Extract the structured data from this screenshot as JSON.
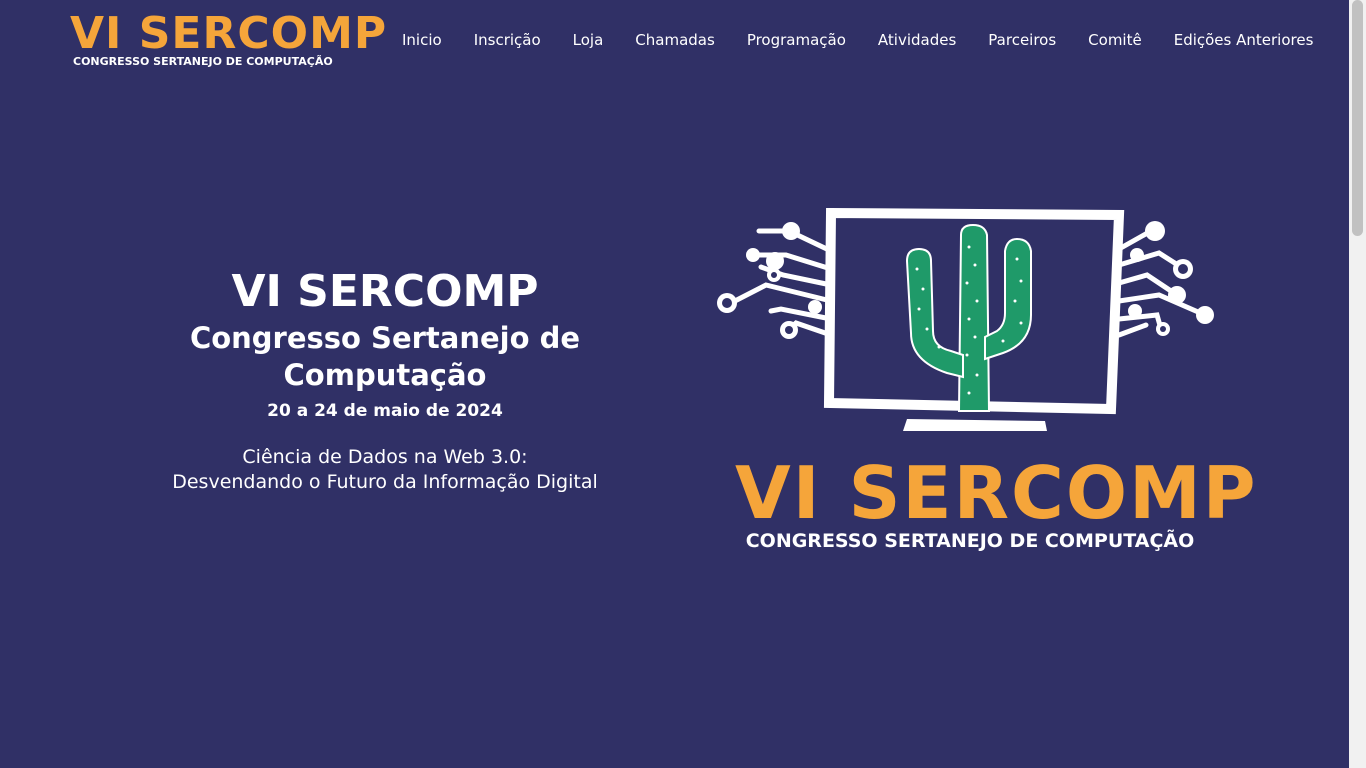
{
  "header": {
    "brand_title": "VI SERCOMP",
    "brand_subtitle": "CONGRESSO SERTANEJO DE COMPUTAÇÃO",
    "nav": [
      {
        "label": "Inicio"
      },
      {
        "label": "Inscrição"
      },
      {
        "label": "Loja"
      },
      {
        "label": "Chamadas"
      },
      {
        "label": "Programação"
      },
      {
        "label": "Atividades"
      },
      {
        "label": "Parceiros"
      },
      {
        "label": "Comitê"
      },
      {
        "label": "Edições Anteriores"
      }
    ]
  },
  "hero": {
    "title": "VI SERCOMP",
    "subtitle": "Congresso Sertanejo de Computação",
    "date": "20 a 24 de maio de 2024",
    "theme_line1": "Ciência de Dados na Web 3.0:",
    "theme_line2": "Desvendando o Futuro da Informação Digital"
  },
  "illustration": {
    "logo_title": "VI SERCOMP",
    "logo_subtitle": "CONGRESSO SERTANEJO DE COMPUTAÇÃO",
    "icon": "cactus-monitor-icon"
  },
  "colors": {
    "background": "#303066",
    "accent": "#f5a53a",
    "cactus": "#1f9a69",
    "text": "#ffffff"
  }
}
